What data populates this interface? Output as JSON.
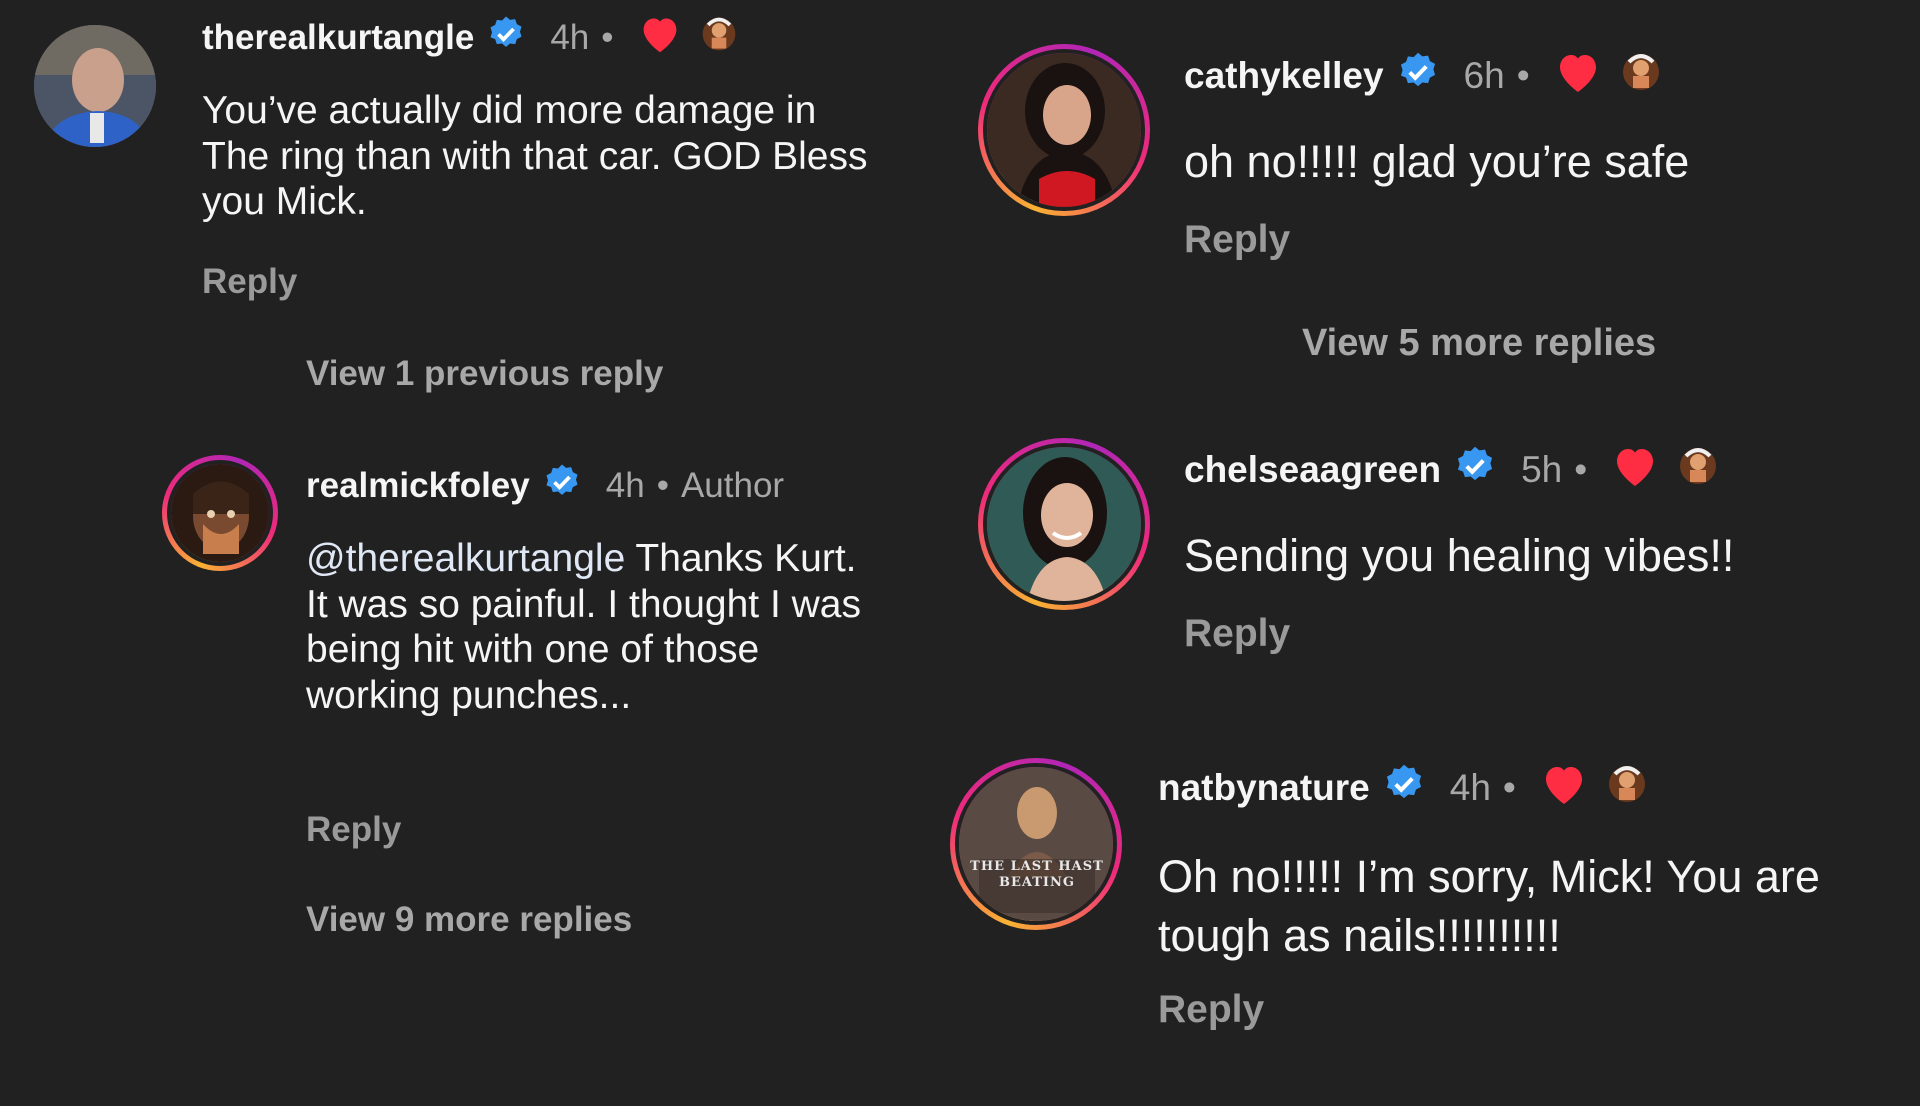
{
  "comments": {
    "kurt": {
      "username": "therealkurtangle",
      "time": "4h",
      "text": "You’ve actually did more damage in The ring than with that car. GOD Bless you Mick.",
      "reply": "Reply",
      "thread": "View 1 previous reply"
    },
    "mick": {
      "username": "realmickfoley",
      "time": "4h",
      "author_label": "Author",
      "mention": "@therealkurtangle",
      "text": " Thanks Kurt.  It was so painful. I thought I was being hit with one of those working punches...",
      "reply": "Reply",
      "thread": "View 9 more replies"
    },
    "cathy": {
      "username": "cathykelley",
      "time": "6h",
      "text": "oh no!!!!! glad you’re safe",
      "reply": "Reply",
      "thread": "View 5 more replies"
    },
    "chelsea": {
      "username": "chelseaagreen",
      "time": "5h",
      "text": "Sending you healing vibes!!",
      "reply": "Reply"
    },
    "nat": {
      "username": "natbynature",
      "time": "4h",
      "text": "Oh no!!!!! I’m sorry, Mick! You are tough as nails!!!!!!!!!!",
      "reply": "Reply",
      "avatar_text": "THE LAST HAST BEATING"
    }
  },
  "dot": "•",
  "icons": {
    "verified": "verified-badge-icon",
    "heart": "heart-icon",
    "reaction": "creator-avatar-reaction-icon"
  },
  "colors": {
    "background": "#212121",
    "verified": "#3897f0",
    "heart": "#ff2d44",
    "muted": "#a8a8a8",
    "story_ring": "#ee2a7b"
  }
}
